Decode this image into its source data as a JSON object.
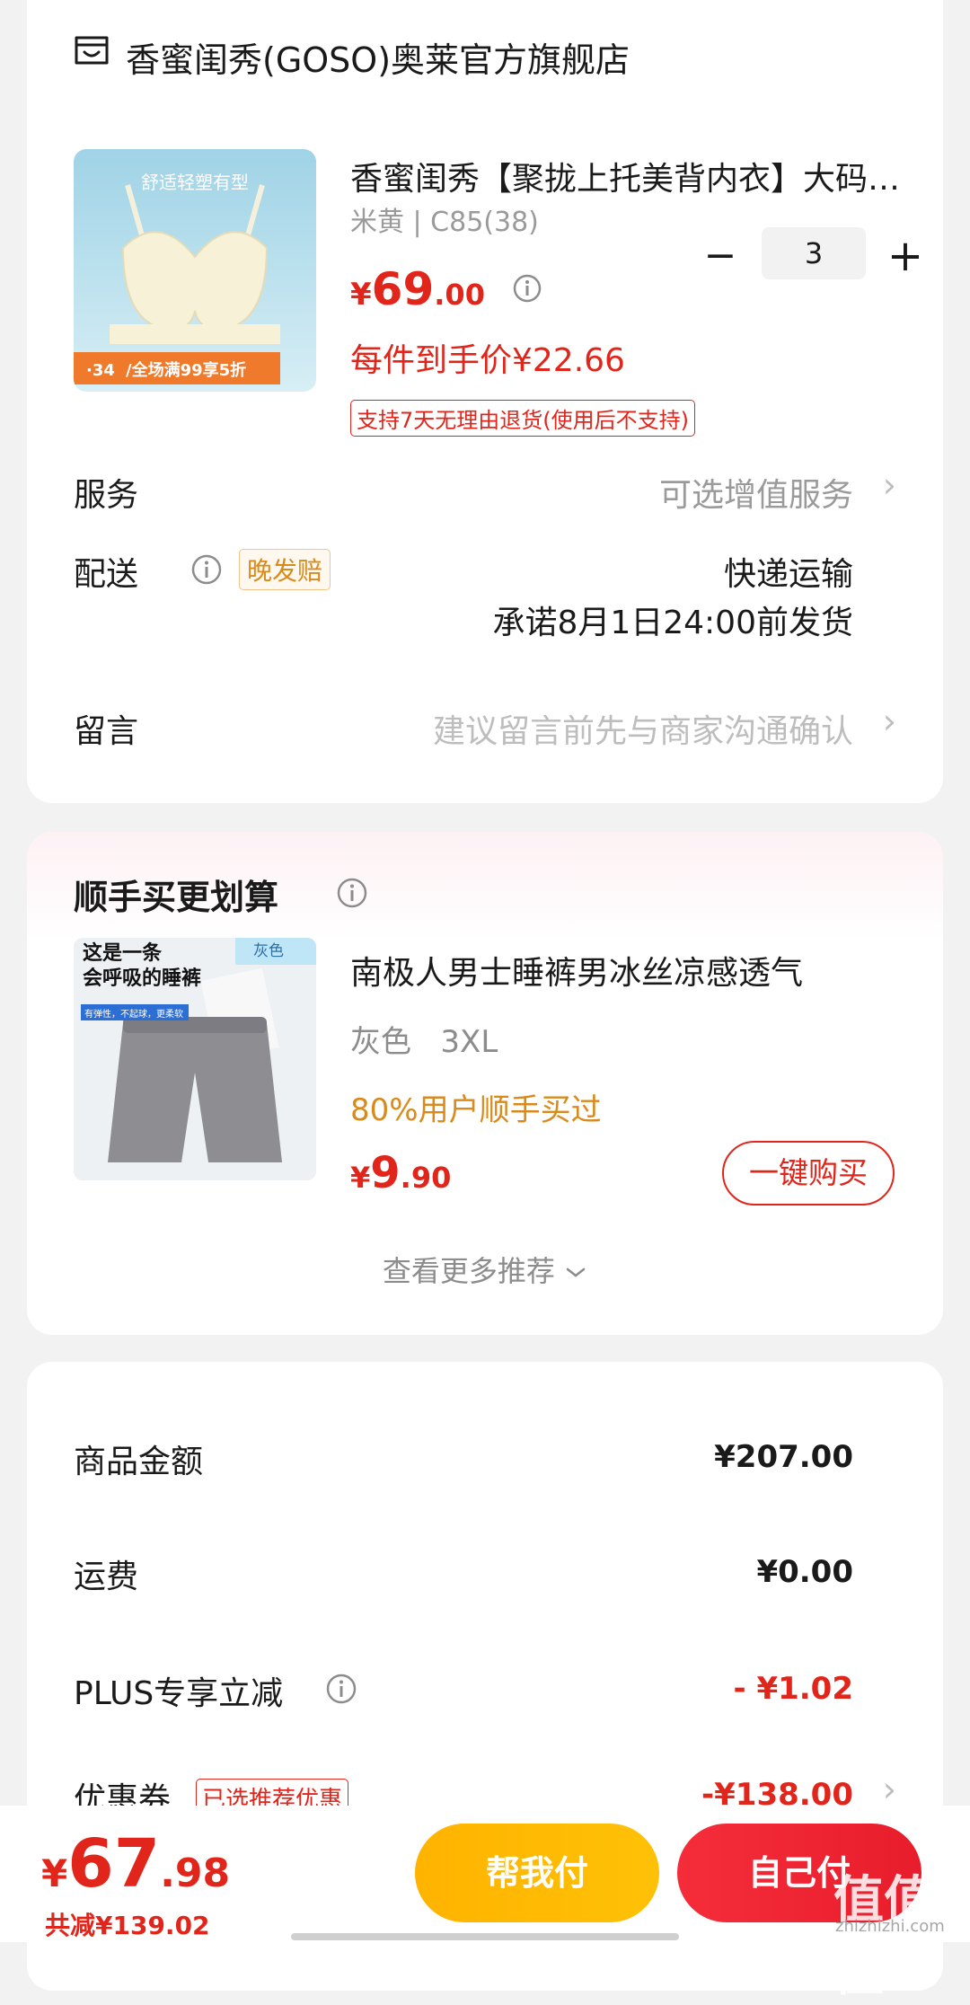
{
  "shop": {
    "name": "香蜜闺秀(GOSO)奥莱官方旗舰店",
    "product": {
      "image_text": {
        "slogan": "舒适轻塑有型",
        "promo_prefix": "·34",
        "promo": "/全场满99享5折"
      },
      "title": "香蜜闺秀【聚拢上托美背内衣】大码文胸女",
      "variant": "米黄 | C85(38)",
      "price_symbol": "¥",
      "price_int": "69",
      "price_dec": ".00",
      "quantity": "3",
      "minus": "−",
      "plus": "+",
      "per_item_price": "每件到手价¥22.66",
      "return_policy": "支持7天无理由退货(使用后不支持)"
    },
    "service": {
      "label": "服务",
      "value": "可选增值服务"
    },
    "delivery": {
      "label": "配送",
      "badge": "晚发赔",
      "method": "快递运输",
      "promise": "承诺8月1日24:00前发货"
    },
    "message": {
      "label": "留言",
      "placeholder": "建议留言前先与商家沟通确认"
    }
  },
  "recommend": {
    "title": "顺手买更划算",
    "item": {
      "image_text": {
        "line1": "这是一条",
        "line2": "会呼吸的睡裤",
        "tag": "灰色",
        "sub": "有弹性，不起球，更柔软"
      },
      "name": "南极人男士睡裤男冰丝凉感透气",
      "variant": "灰色   3XL",
      "social": "80%用户顺手买过",
      "price_symbol": "¥",
      "price_int": "9",
      "price_dec": ".90",
      "button": "一键购买"
    },
    "more": "查看更多推荐"
  },
  "summary": {
    "goods": {
      "label": "商品金额",
      "value": "¥207.00"
    },
    "shipping": {
      "label": "运费",
      "value": "¥0.00"
    },
    "plus": {
      "label": "PLUS专享立减",
      "value": "- ¥1.02"
    },
    "coupon": {
      "label": "优惠券",
      "badge": "已选推荐优惠",
      "value": "-¥138.00"
    }
  },
  "bottom": {
    "price_symbol": "¥",
    "price_int": "67",
    "price_dec": ".98",
    "saved": "共减¥139.02",
    "help_pay": "帮我付",
    "self_pay": "自己付",
    "watermark": "值值值",
    "watermark_sub": "zhizhizhi.com"
  },
  "colors": {
    "accent_red": "#e1251b",
    "orange": "#d98a1b",
    "help_pay_yellow": "#ffb300",
    "self_pay_red": "#f52d3a"
  },
  "icons": [
    "shop-icon",
    "info-icon",
    "chevron-right-icon",
    "chevron-down-icon"
  ]
}
